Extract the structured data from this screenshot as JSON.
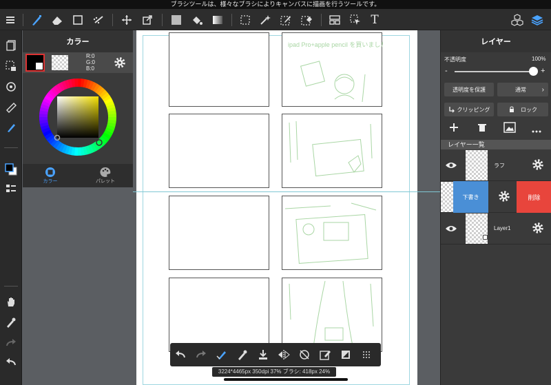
{
  "hint_bar": {
    "text": "ブラシツールは、様々なブラシによりキャンバスに描画を行うツールです。"
  },
  "toolbar": {
    "items": [
      "menu-icon",
      "brush-icon",
      "eraser-icon",
      "rectangle-icon",
      "dotted-brush-icon",
      "move-icon",
      "transform-icon",
      "fill-color-icon",
      "bucket-icon",
      "gradient-icon",
      "select-rect-icon",
      "magic-wand-icon",
      "select-pen-icon",
      "select-eraser-icon",
      "frame-icon",
      "pointer-icon",
      "text-icon",
      "material-icon",
      "layers-icon"
    ]
  },
  "color_panel": {
    "title": "カラー",
    "rgb": {
      "r": "R:0",
      "g": "G:0",
      "b": "B:0"
    },
    "tabs": [
      {
        "label": "カラー"
      },
      {
        "label": "パレット"
      }
    ]
  },
  "layer_panel": {
    "title": "レイヤー",
    "opacity_label": "不透明度",
    "opacity_value": "100%",
    "opacity": 1.0,
    "protect_button": "透明度を保護",
    "blend_button": "通常",
    "clipping_button": "クリッピング",
    "lock_button": "ロック",
    "list_header": "レイヤー一覧",
    "layers": [
      {
        "name": "ラフ"
      },
      {
        "name": "下書き",
        "delete_label": "削除"
      },
      {
        "name": "Layer1"
      }
    ]
  },
  "canvas": {
    "sketch_text": "ipad Pro+apple pencil を買いました!"
  },
  "status": {
    "text": "3224*4465px 350dpi 37% ブラシ: 418px 24%"
  },
  "colors": {
    "accent": "#4aa3ff",
    "delete": "#e8453c",
    "swipe": "#4a8fd6"
  }
}
